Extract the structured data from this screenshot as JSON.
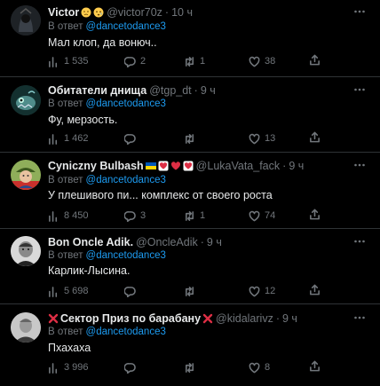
{
  "colors": {
    "background": "#000000",
    "text": "#e7e9ea",
    "muted": "#71767b",
    "link": "#1d9bf0",
    "divider": "#2f3336"
  },
  "tweets": [
    {
      "author": "Victor",
      "author_emoji": [
        "sad-face-emoji",
        "worried-face-emoji"
      ],
      "handle": "@victor70z",
      "time": "10 ч",
      "reply_prefix": "В ответ",
      "reply_to": "@dancetodance3",
      "text": "Мал клоп, да вонюч..",
      "views": "1 535",
      "replies": "2",
      "retweets": "1",
      "likes": "38"
    },
    {
      "author": "Обитатели днища",
      "handle": "@tgp_dt",
      "time": "9 ч",
      "reply_prefix": "В ответ",
      "reply_to": "@dancetodance3",
      "text": "Фу, мерзость.",
      "views": "1 462",
      "replies": "",
      "retweets": "",
      "likes": "13"
    },
    {
      "author": "Cyniczny Bulbash",
      "author_emoji": [
        "ukraine-flag-emoji",
        "heart-emoji",
        "red-heart-emoji",
        "heart-emoji"
      ],
      "handle": "@LukaVata_fack",
      "time": "9 ч",
      "reply_prefix": "В ответ",
      "reply_to": "@dancetodance3",
      "text": "У плешивого пи... комплекс от своего роста",
      "views": "8 450",
      "replies": "3",
      "retweets": "1",
      "likes": "74"
    },
    {
      "author": "Bon Oncle Adik.",
      "handle": "@OncleAdik",
      "time": "9 ч",
      "reply_prefix": "В ответ",
      "reply_to": "@dancetodance3",
      "text": "Карлик-Лысина.",
      "views": "5 698",
      "replies": "",
      "retweets": "",
      "likes": "12"
    },
    {
      "author": "Сектор Приз по барабану",
      "author_emoji": [
        "cross-mark-emoji"
      ],
      "handle": "@kidalarivz",
      "time": "9 ч",
      "reply_prefix": "В ответ",
      "reply_to": "@dancetodance3",
      "text": "Пхахаха",
      "views": "3 996",
      "replies": "",
      "retweets": "",
      "likes": "8"
    }
  ]
}
